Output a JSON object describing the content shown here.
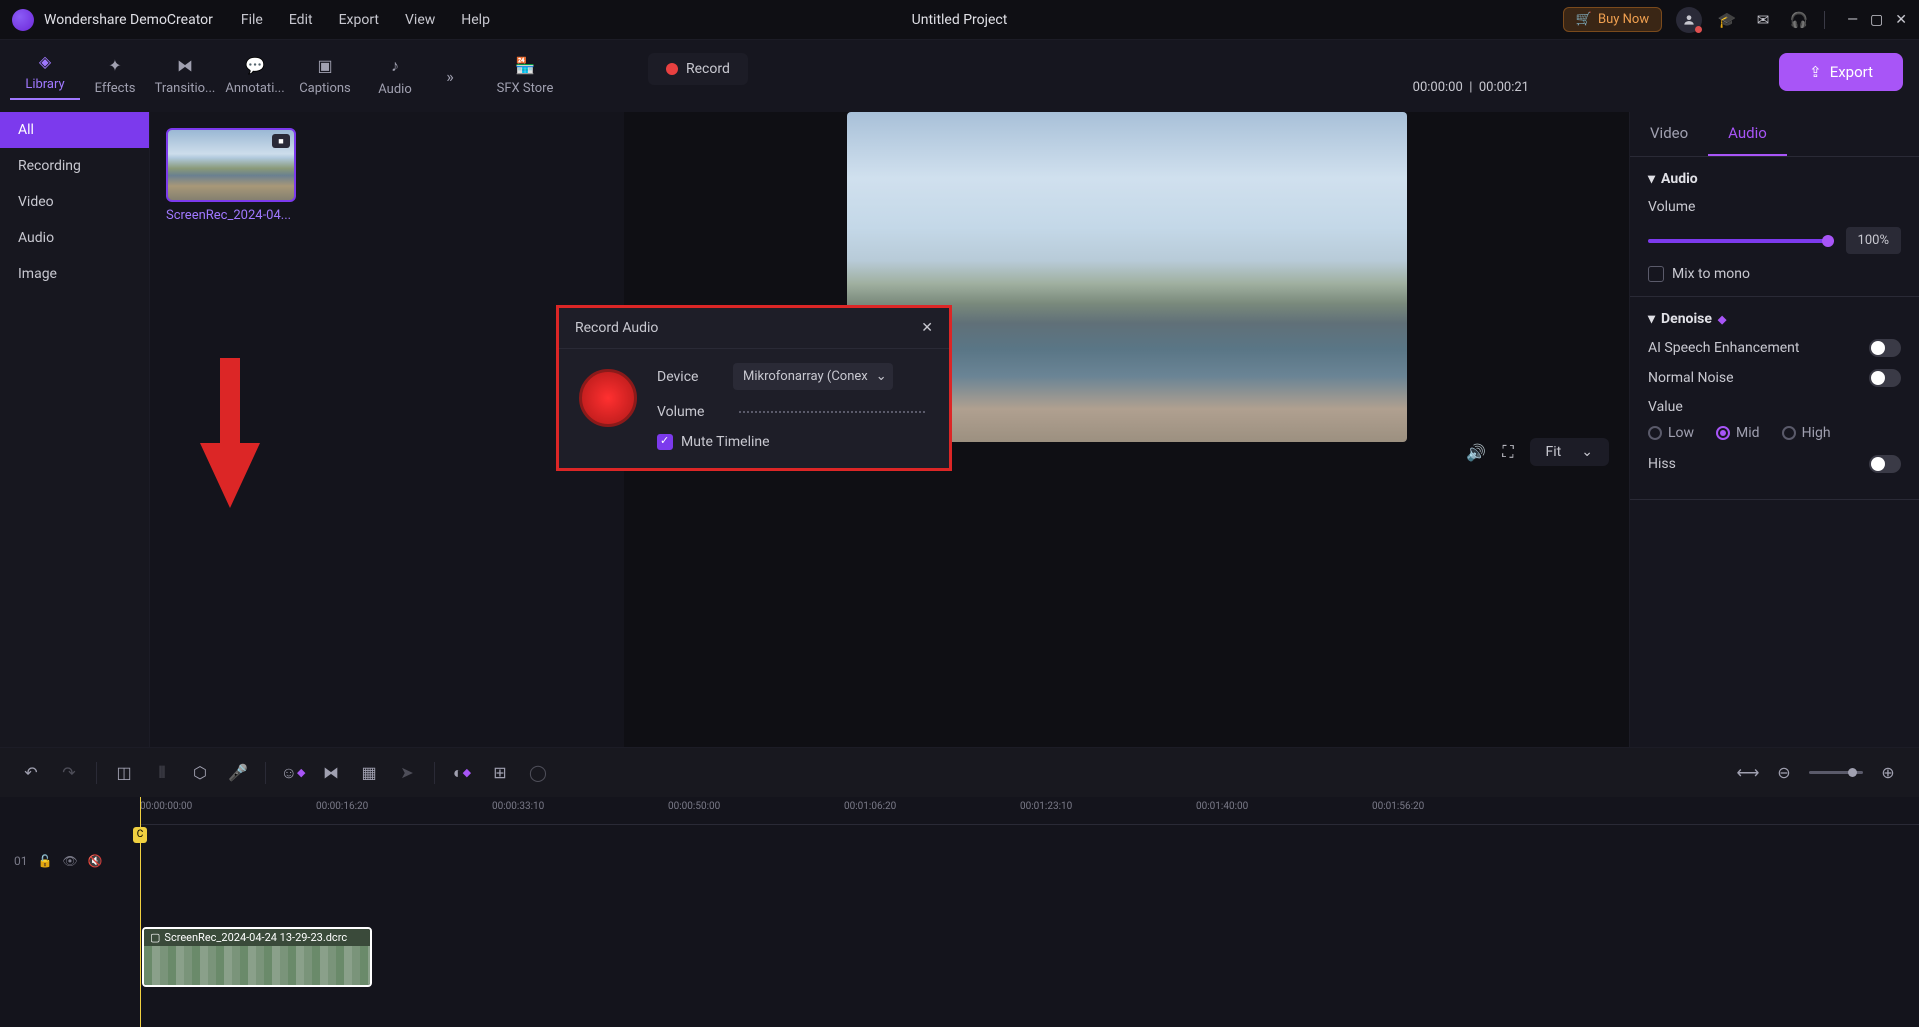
{
  "app_name": "Wondershare DemoCreator",
  "project_title": "Untitled Project",
  "menus": [
    "File",
    "Edit",
    "Export",
    "View",
    "Help"
  ],
  "buy_now": "Buy Now",
  "export_label": "Export",
  "record_label": "Record",
  "tool_tabs": [
    {
      "label": "Library",
      "active": true
    },
    {
      "label": "Effects"
    },
    {
      "label": "Transitio..."
    },
    {
      "label": "Annotati..."
    },
    {
      "label": "Captions"
    },
    {
      "label": "Audio"
    }
  ],
  "sfx_label": "SFX Store",
  "sidebar_cats": [
    {
      "label": "All",
      "active": true
    },
    {
      "label": "Recording"
    },
    {
      "label": "Video"
    },
    {
      "label": "Audio"
    },
    {
      "label": "Image"
    }
  ],
  "media_item_label": "ScreenRec_2024-04...",
  "time_current": "00:00:00",
  "time_total": "00:00:21",
  "fit_label": "Fit",
  "props_tabs": [
    "Video",
    "Audio"
  ],
  "audio_section": "Audio",
  "volume_label": "Volume",
  "volume_value": "100%",
  "mix_mono": "Mix to mono",
  "denoise_section": "Denoise",
  "ai_speech": "AI Speech Enhancement",
  "normal_noise": "Normal Noise",
  "value_label": "Value",
  "value_options": [
    "Low",
    "Mid",
    "High"
  ],
  "hiss_label": "Hiss",
  "ruler_ticks": [
    "00:00:00:00",
    "00:00:16:20",
    "00:00:33:10",
    "00:00:50:00",
    "00:01:06:20",
    "00:01:23:10",
    "00:01:40:00",
    "00:01:56:20"
  ],
  "track_number": "01",
  "clip_label": "ScreenRec_2024-04-24 13-29-23.dcrc",
  "dialog": {
    "title": "Record Audio",
    "device_label": "Device",
    "device_value": "Mikrofonarray (Conex",
    "volume_label": "Volume",
    "mute_timeline": "Mute Timeline"
  }
}
